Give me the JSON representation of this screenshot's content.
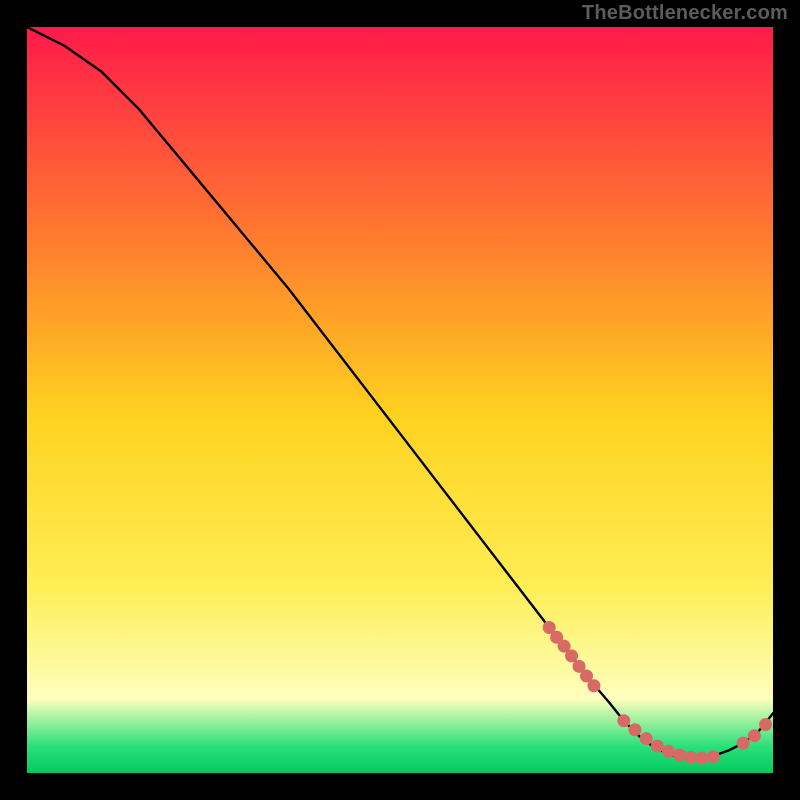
{
  "watermark": "TheBottlenecker.com",
  "colors": {
    "background": "#000000",
    "curve": "#000000",
    "marker": "#d86a66",
    "watermark_text": "#5c5c5c",
    "gradient_top": "#ff1a4b",
    "gradient_upper": "#ff7a2f",
    "gradient_mid": "#ffd21f",
    "gradient_low_yellow": "#ffee55",
    "gradient_pale_yellow": "#feffbd",
    "gradient_green": "#28e07a",
    "gradient_bottom": "#04c95e"
  },
  "chart_data": {
    "type": "line",
    "title": "",
    "xlabel": "",
    "ylabel": "",
    "xlim": [
      0,
      100
    ],
    "ylim": [
      0,
      100
    ],
    "series": [
      {
        "name": "curve",
        "x": [
          0,
          5,
          10,
          15,
          20,
          25,
          30,
          35,
          40,
          45,
          50,
          55,
          60,
          65,
          70,
          72,
          75,
          78,
          80,
          82,
          84,
          86,
          88,
          90,
          92,
          94,
          96,
          98,
          100
        ],
        "y": [
          100,
          97.5,
          94,
          89,
          83,
          77,
          71,
          65,
          58.5,
          52,
          45.5,
          39,
          32.5,
          26,
          19.5,
          17,
          13,
          9.5,
          7,
          5,
          3.5,
          2.5,
          2,
          2,
          2.3,
          3,
          4,
          5.5,
          8
        ]
      }
    ],
    "markers": [
      {
        "name": "left-cluster",
        "x": [
          70,
          71,
          72,
          73,
          74,
          75,
          76
        ],
        "y": [
          19.5,
          18.2,
          17,
          15.7,
          14.3,
          13,
          11.7
        ]
      },
      {
        "name": "bottom-cluster",
        "x": [
          80,
          81.5,
          83,
          84.5,
          86,
          87.5,
          89,
          90.5,
          92
        ],
        "y": [
          7,
          5.8,
          4.6,
          3.6,
          2.9,
          2.4,
          2.1,
          2,
          2.2
        ]
      },
      {
        "name": "right-cluster",
        "x": [
          96,
          97.5,
          99
        ],
        "y": [
          4,
          5,
          6.5
        ]
      }
    ]
  }
}
